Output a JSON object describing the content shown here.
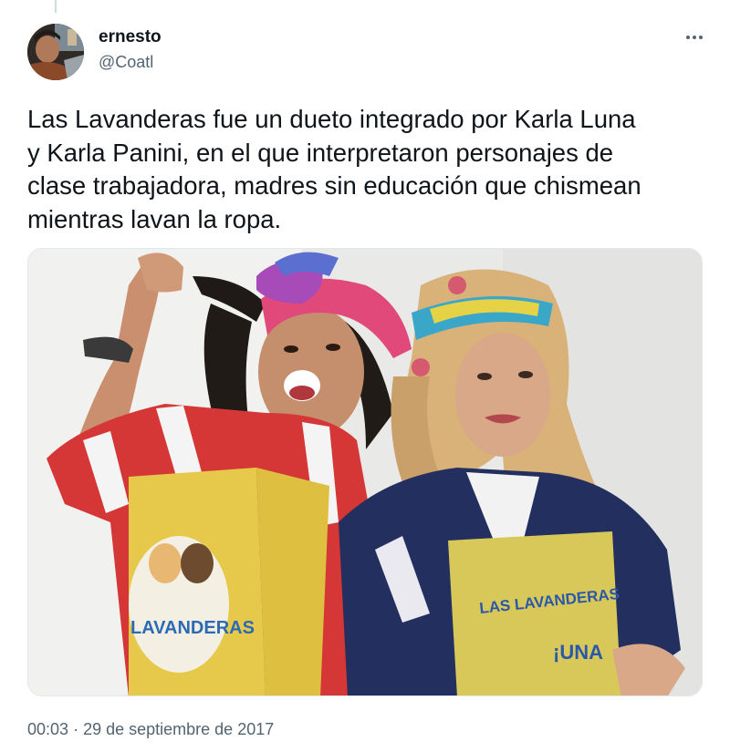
{
  "author": {
    "display_name": "ernesto",
    "handle": "@Coatl"
  },
  "tweet": {
    "text_lines": [
      "Las Lavanderas fue un dueto integrado por Karla Luna",
      "y Karla Panini, en el que interpretaron personajes de",
      "clase trabajadora, madres sin educación que chismean",
      "mientras lavan la ropa."
    ]
  },
  "media": {
    "apron_logo_text": "LAVANDERAS",
    "apron_right_text": "LAS LAVANDERAS",
    "apron_right_text2": "¡UNA"
  },
  "meta": {
    "time": "00:03",
    "separator": "·",
    "date": "29 de septiembre de 2017"
  },
  "icons": {
    "more": "more-horizontal-icon"
  }
}
